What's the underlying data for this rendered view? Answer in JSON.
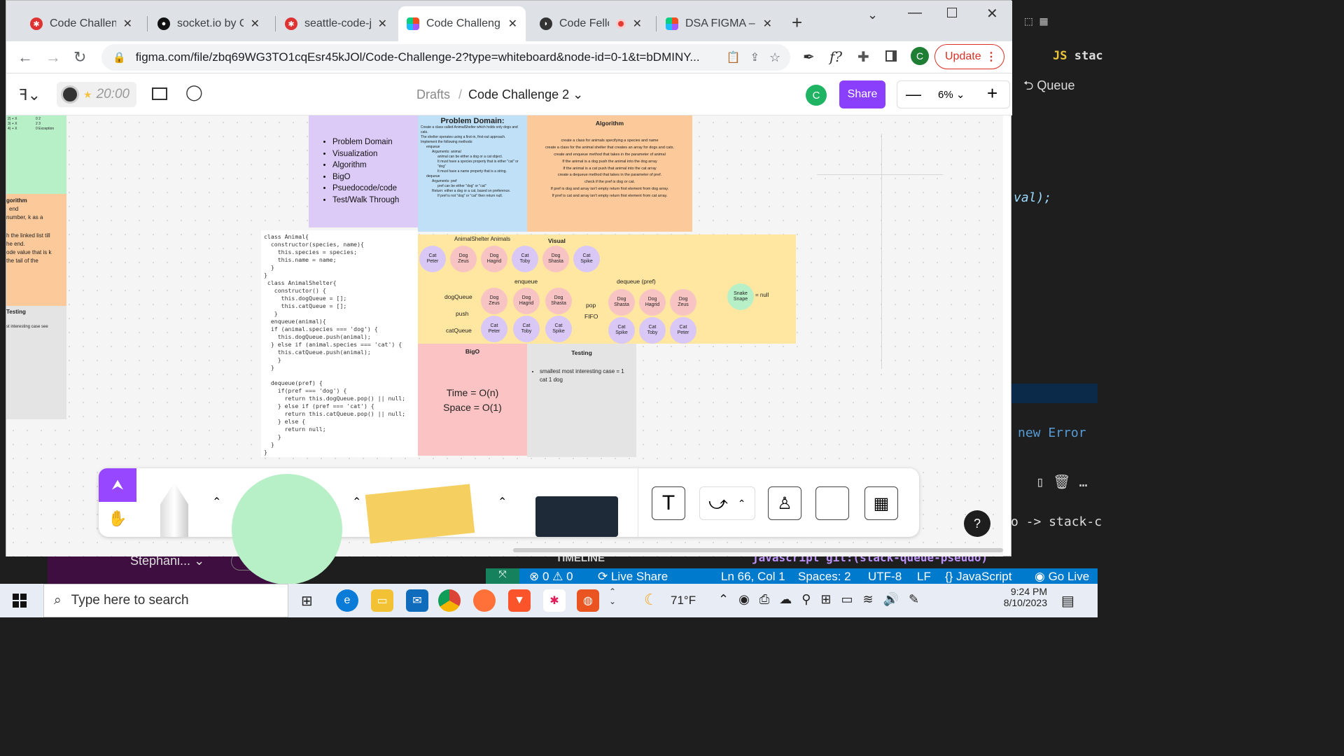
{
  "browser": {
    "tabs": [
      {
        "title": "Code Challenge",
        "active": false,
        "favicon": "code-fellows-icon"
      },
      {
        "title": "socket.io by Che",
        "active": false,
        "favicon": "github-icon"
      },
      {
        "title": "seattle-code-jav",
        "active": false,
        "favicon": "code-fellows-icon"
      },
      {
        "title": "Code Challenge",
        "active": true,
        "favicon": "figma-icon"
      },
      {
        "title": "Code Fellow",
        "active": false,
        "favicon": "canvas-icon"
      },
      {
        "title": "DSA FIGMA – Fi",
        "active": false,
        "favicon": "figma-icon"
      }
    ],
    "url": "figma.com/file/zbq69WG3TO1cqEsr45kJOl/Code-Challenge-2?type=whiteboard&node-id=0-1&t=bDMINY...",
    "profile_initial": "C",
    "update_label": "Update"
  },
  "figma": {
    "timer": "20:00",
    "breadcrumb_root": "Drafts",
    "file_name": "Code Challenge 2",
    "avatar_initial": "C",
    "share_label": "Share",
    "zoom": "6%"
  },
  "board": {
    "left_green": [
      "2) + X",
      "0 2",
      "3) + X",
      "2 3",
      "4) + X",
      "0 Exception"
    ],
    "left_orange": [
      "gorithm",
      "end",
      "number, k as a",
      "h the linked list till",
      "he end.",
      "ode value that is k",
      "the tail of the"
    ],
    "left_gray": [
      "Testing",
      "st interesting case see"
    ],
    "outline": [
      "Problem Domain",
      "Visualization",
      "Algorithm",
      "BigO",
      "Psuedocode/code",
      "Test/Walk Through"
    ],
    "problem_title": "Problem Domain:",
    "problem_lines": [
      "Create a class called AnimalShelter which holds only dogs and cats.",
      "The shelter operates using a first-in, first-out approach.",
      "Implement the following methods:",
      "enqueue",
      "Arguments: animal",
      "animal can be either a dog or a cat object.",
      "It must have a species property that is either \"cat\" or \"dog\"",
      "It must have a name property that is a string.",
      "dequeue",
      "Arguments: pref",
      "pref can be either \"dog\" or \"cat\"",
      "Return: either a dog or a cat, based on preference.",
      "If pref is not \"dog\" or \"cat\" then return null."
    ],
    "algorithm_title": "Algorithm",
    "algorithm_lines": [
      "create a class for animals specifying a species and name",
      "create a class for the animal shelter that creates an array for dogs and cats.",
      "create and enqueue method that takes in the parameter of animal",
      "If the animal is a dog push the animal into the dog array",
      "If the animal is a cat push that animal into the cat array",
      "create a dequeue method that takes in the parameter of pref.",
      "check if the pref is dog or cat.",
      "If pref is dog and array isn't empty return first element from dog array.",
      "If pref is cat and array isn't empty return first element from cat array."
    ],
    "code": "class Animal{\n  constructor(species, name){\n    this.species = species;\n    this.name = name;\n  }\n}\n class AnimalShelter{\n   constructor() {\n     this.dogQueue = [];\n     this.catQueue = [];\n   }\n  enqueue(animal){\n  if (animal.species === 'dog') {\n    this.dogQueue.push(animal);\n  } else if (animal.species === 'cat') {\n    this.catQueue.push(animal);\n    }\n  }\n\n  dequeue(pref) {\n    if(pref === 'dog') {\n      return this.dogQueue.pop() || null;\n    } else if (pref === 'cat') {\n      return this.catQueue.pop() || null;\n    } else {\n      return null;\n    }\n  }\n}",
    "visual_title": "Visual",
    "shelter_title": "AnimalShelter Animals",
    "animals": [
      {
        "type": "Cat",
        "name": "Peter"
      },
      {
        "type": "Dog",
        "name": "Zeus"
      },
      {
        "type": "Dog",
        "name": "Hagrid"
      },
      {
        "type": "Cat",
        "name": "Toby"
      },
      {
        "type": "Dog",
        "name": "Shasta"
      },
      {
        "type": "Cat",
        "name": "Spike"
      }
    ],
    "enqueue_label": "enqueue",
    "dequeue_label": "dequeue (pref)",
    "dogqueue_label": "dogQueue",
    "push_label": "push",
    "catqueue_label": "catQueue",
    "pop_label": "pop",
    "fifo_label": "FIFO",
    "enq_dogs": [
      {
        "type": "Dog",
        "name": "Zeus"
      },
      {
        "type": "Dog",
        "name": "Hagrid"
      },
      {
        "type": "Dog",
        "name": "Shasta"
      }
    ],
    "enq_cats": [
      {
        "type": "Cat",
        "name": "Peter"
      },
      {
        "type": "Cat",
        "name": "Toby"
      },
      {
        "type": "Cat",
        "name": "Spike"
      }
    ],
    "deq_dogs": [
      {
        "type": "Dog",
        "name": "Shasta"
      },
      {
        "type": "Dog",
        "name": "Hagrid"
      },
      {
        "type": "Dog",
        "name": "Zeus"
      }
    ],
    "deq_cats": [
      {
        "type": "Cat",
        "name": "Spike"
      },
      {
        "type": "Cat",
        "name": "Toby"
      },
      {
        "type": "Cat",
        "name": "Peter"
      }
    ],
    "snake": {
      "type": "Snake",
      "name": "Snape"
    },
    "snake_result": "= null",
    "bigo_title": "BigO",
    "time": "Time = O(n)",
    "space": "Space = O(1)",
    "testing_title": "Testing",
    "testing_text": "smallest most interesting case = 1 cat 1 dog"
  },
  "vscode": {
    "queue_label": "Queue",
    "val_text": "val);",
    "error_text": "new Error",
    "stack_text": "o -> stack-c",
    "timeline": "TIMELINE",
    "branch": "javascript git:(stack-queue-pseudo)",
    "errors": "0",
    "warnings": "0",
    "liveshare": "Live Share",
    "position": "Ln 66, Col 1",
    "spaces": "Spaces: 2",
    "encoding": "UTF-8",
    "eol": "LF",
    "language": "JavaScript",
    "golive": "Go Live",
    "stephanie": "Stephani..."
  },
  "taskbar": {
    "search_placeholder": "Type here to search",
    "weather": "71°F",
    "time": "9:24 PM",
    "date": "8/10/2023"
  },
  "colors": {
    "figma_purple": "#9747ff",
    "share_purple": "#8a3ffc",
    "update_red": "#d93025",
    "lavender": "#dccbf7",
    "light_blue": "#bfe0f7",
    "peach": "#fbc99a",
    "yellow": "#ffe7a1",
    "pink": "#fbc3c3",
    "gray": "#e4e4e4",
    "green": "#b7f0c7"
  }
}
